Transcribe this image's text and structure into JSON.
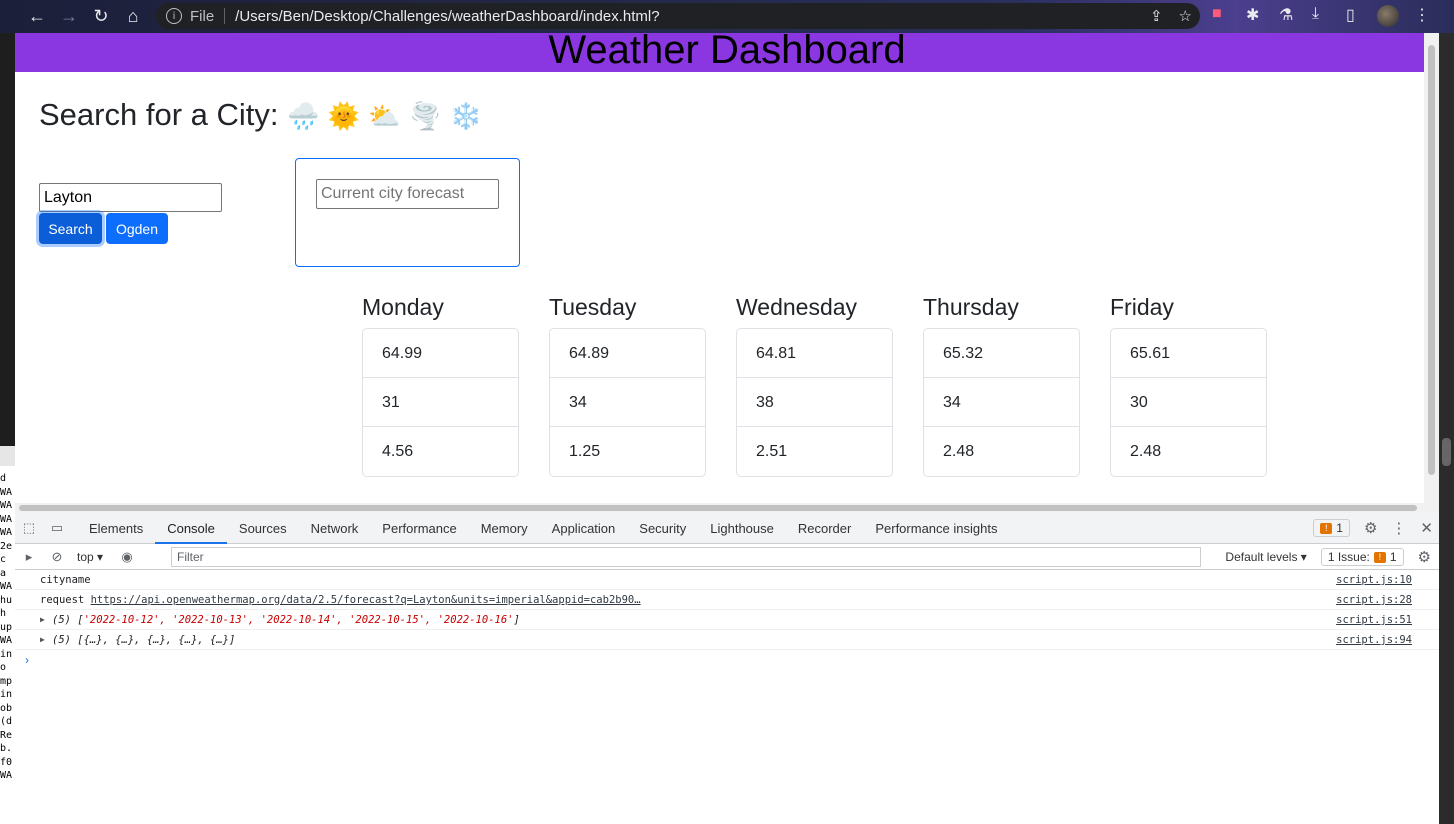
{
  "browser": {
    "file_label": "File",
    "url": "/Users/Ben/Desktop/Challenges/weatherDashboard/index.html?"
  },
  "page": {
    "title": "Weather Dashboard",
    "search_title": "Search for a City:",
    "weather_emojis": "🌧️ 🌞 ⛅ 🌪️ ❄️",
    "city_input_value": "Layton",
    "search_button": "Search",
    "history_button": "Ogden",
    "forecast_placeholder": "Current city forecast",
    "days": [
      {
        "name": "Monday",
        "temp": "64.99",
        "humidity": "31",
        "wind": "4.56"
      },
      {
        "name": "Tuesday",
        "temp": "64.89",
        "humidity": "34",
        "wind": "1.25"
      },
      {
        "name": "Wednesday",
        "temp": "64.81",
        "humidity": "38",
        "wind": "2.51"
      },
      {
        "name": "Thursday",
        "temp": "65.32",
        "humidity": "34",
        "wind": "2.48"
      },
      {
        "name": "Friday",
        "temp": "65.61",
        "humidity": "30",
        "wind": "2.48"
      }
    ]
  },
  "devtools": {
    "tabs": [
      "Elements",
      "Console",
      "Sources",
      "Network",
      "Performance",
      "Memory",
      "Application",
      "Security",
      "Lighthouse",
      "Recorder",
      "Performance insights"
    ],
    "issues_count": "1",
    "context": "top",
    "filter_placeholder": "Filter",
    "levels": "Default levels",
    "issue_label": "1 Issue:",
    "issue_count": "1",
    "console": [
      {
        "text": "cityname",
        "src": "script.js:10"
      },
      {
        "prefix": "request ",
        "link": "https://api.openweathermap.org/data/2.5/forecast?q=Layton&units=imperial&appid=cab2b90…",
        "src": "script.js:28"
      },
      {
        "prefix": "(5) [",
        "dates": "'2022-10-12', '2022-10-13', '2022-10-14', '2022-10-15', '2022-10-16'",
        "suffix": "]",
        "src": "script.js:51"
      },
      {
        "text": "(5) [{…}, {…}, {…}, {…}, {…}]",
        "src": "script.js:94"
      }
    ]
  },
  "terminal_fragments": [
    "d",
    "WA",
    "WA",
    "WA",
    "WA",
    "2e",
    "c",
    "a",
    "WA",
    "hu",
    "h",
    "up",
    "WA",
    "in",
    "o",
    "mp",
    "in",
    "ob",
    "(d",
    "Re",
    "b.",
    "f0",
    "WA"
  ]
}
